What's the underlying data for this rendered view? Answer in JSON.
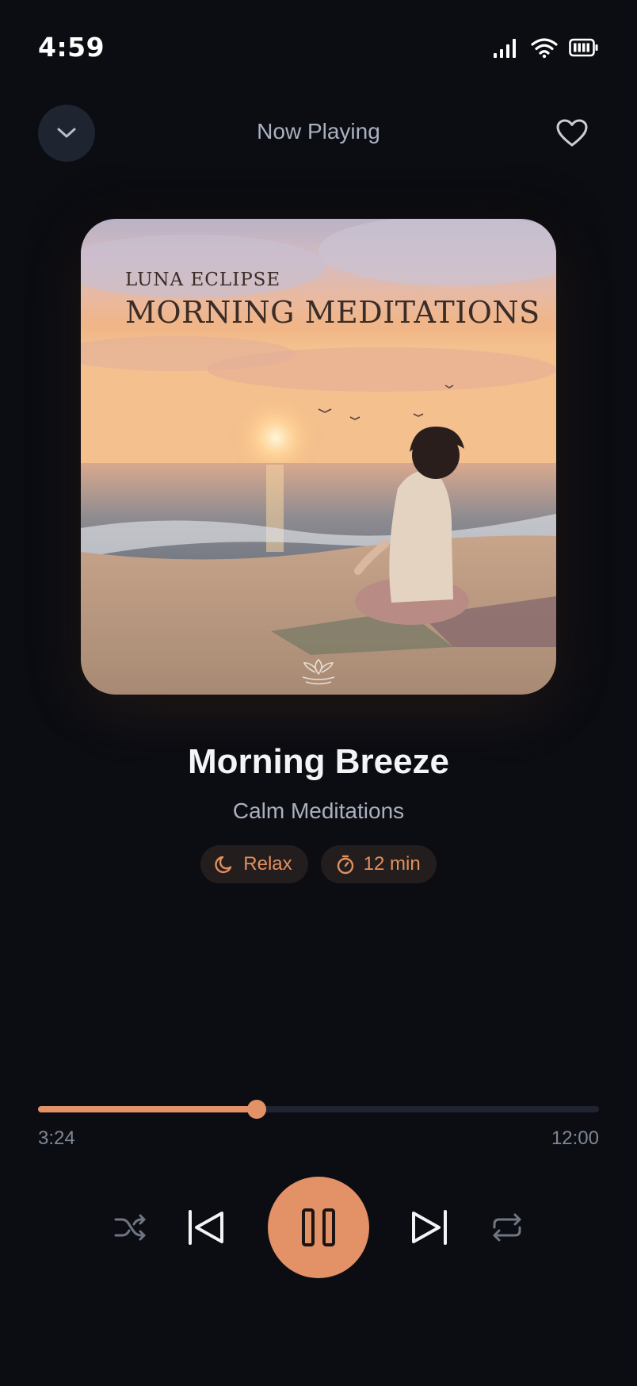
{
  "status_bar": {
    "time": "4:59",
    "icons": [
      "signal-icon",
      "wifi-icon",
      "battery-icon"
    ]
  },
  "header": {
    "title": "Now Playing",
    "collapse_icon": "chevron-down-icon",
    "favorite_icon": "heart-icon"
  },
  "artwork": {
    "artist_text": "LUNA ECLIPSE",
    "title_text": "MORNING MEDITATIONS"
  },
  "track": {
    "title": "Morning Breeze",
    "artist": "Calm Meditations",
    "tags": [
      {
        "icon": "moon-icon",
        "label": "Relax"
      },
      {
        "icon": "timer-icon",
        "label": "12 min"
      }
    ]
  },
  "progress": {
    "current": "3:24",
    "total": "12:00",
    "fraction": 0.39
  },
  "controls": {
    "shuffle_icon": "shuffle-icon",
    "previous_icon": "skip-previous-icon",
    "play_pause_icon": "pause-icon",
    "next_icon": "skip-next-icon",
    "repeat_icon": "repeat-icon"
  },
  "colors": {
    "background": "#0b0d13",
    "accent": "#e39166",
    "chip_bg": "#241d1d",
    "muted_text": "#aab1be"
  }
}
